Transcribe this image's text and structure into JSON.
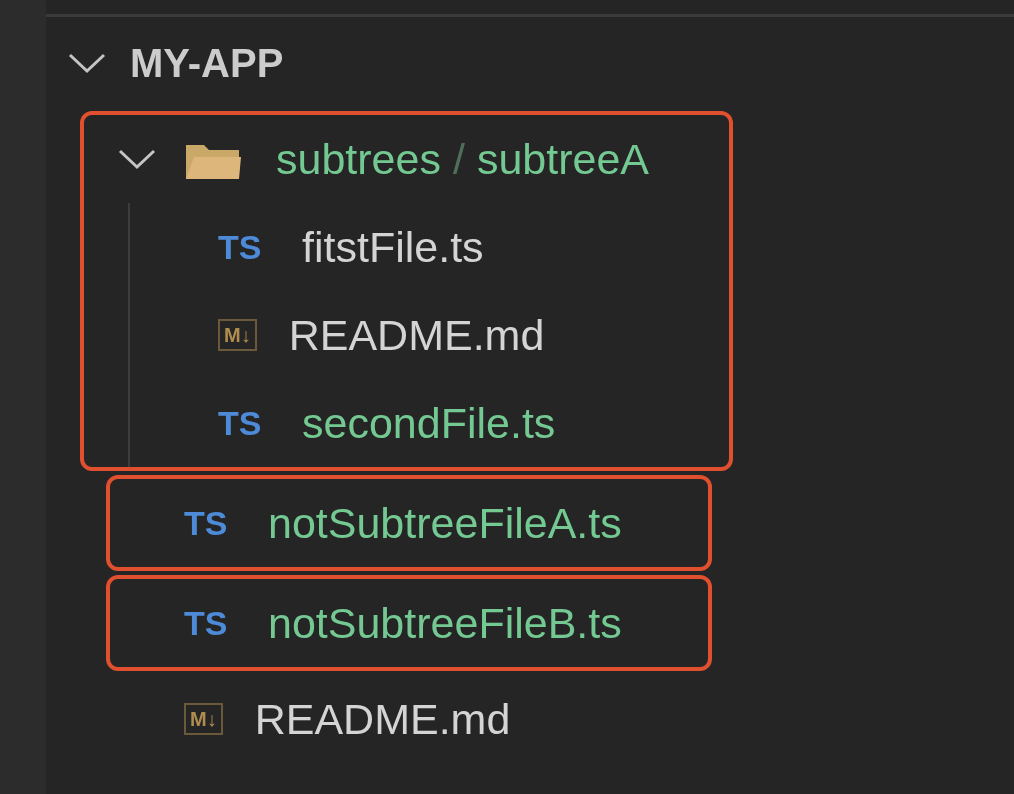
{
  "explorer": {
    "root": {
      "label": "MY-APP",
      "expanded": true,
      "children": [
        {
          "kind": "folder",
          "path": [
            "subtrees",
            "subtreeA"
          ],
          "separator": "/",
          "expanded": true,
          "highlighted": true,
          "untracked": true,
          "children": [
            {
              "kind": "ts",
              "icon_label": "TS",
              "name": "fitstFile.ts",
              "untracked": false,
              "highlighted": false
            },
            {
              "kind": "md",
              "icon_label": "M↓",
              "name": "README.md",
              "untracked": false,
              "highlighted": false
            },
            {
              "kind": "ts",
              "icon_label": "TS",
              "name": "secondFile.ts",
              "untracked": true,
              "highlighted": false
            }
          ]
        },
        {
          "kind": "ts",
          "icon_label": "TS",
          "name": "notSubtreeFileA.ts",
          "untracked": true,
          "highlighted": true
        },
        {
          "kind": "ts",
          "icon_label": "TS",
          "name": "notSubtreeFileB.ts",
          "untracked": true,
          "highlighted": true
        },
        {
          "kind": "md",
          "icon_label": "M↓",
          "name": "README.md",
          "untracked": false,
          "highlighted": false
        }
      ]
    }
  }
}
